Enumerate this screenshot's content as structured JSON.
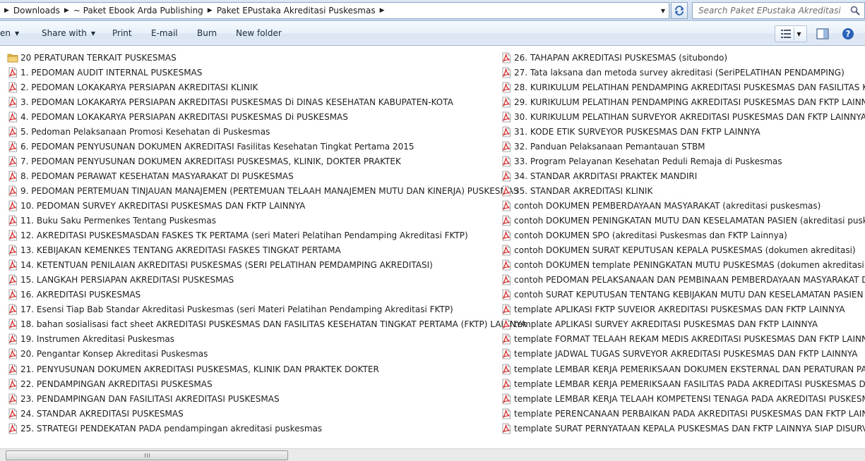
{
  "address_bar": {
    "crumbs": [
      "Downloads",
      "~ Paket Ebook Arda Publishing",
      "Paket EPustaka Akreditasi Puskesmas"
    ]
  },
  "search": {
    "placeholder": "Search Paket EPustaka Akreditasi Pus..."
  },
  "toolbar": {
    "organize_label": "en",
    "share_label": "Share with",
    "print_label": "Print",
    "email_label": "E-mail",
    "burn_label": "Burn",
    "new_folder_label": "New folder"
  },
  "files_left": [
    {
      "name": "20 PERATURAN TERKAIT PUSKESMAS",
      "icon": "folder-icon"
    },
    {
      "name": "1. PEDOMAN AUDIT INTERNAL PUSKESMAS",
      "icon": "pdf-icon"
    },
    {
      "name": "2. PEDOMAN LOKAKARYA PERSIAPAN AKREDITASI KLINIK",
      "icon": "pdf-icon"
    },
    {
      "name": "3. PEDOMAN LOKAKARYA PERSIAPAN AKREDITASI PUSKESMAS Di DINAS KESEHATAN KABUPATEN-KOTA",
      "icon": "pdf-icon"
    },
    {
      "name": "4. PEDOMAN LOKAKARYA PERSIAPAN AKREDITASI PUSKESMAS Di PUSKESMAS",
      "icon": "pdf-icon"
    },
    {
      "name": "5. Pedoman Pelaksanaan Promosi Kesehatan di Puskesmas",
      "icon": "pdf-icon"
    },
    {
      "name": "6. PEDOMAN PENYUSUNAN DOKUMEN AKREDITASI Fasilitas Kesehatan Tingkat Pertama 2015",
      "icon": "pdf-icon"
    },
    {
      "name": "7. PEDOMAN PENYUSUNAN DOKUMEN AKREDITASI PUSKESMAS, KLINIK, DOKTER PRAKTEK",
      "icon": "pdf-icon"
    },
    {
      "name": "8. PEDOMAN PERAWAT KESEHATAN MASYARAKAT DI PUSKESMAS",
      "icon": "pdf-icon"
    },
    {
      "name": "9. PEDOMAN PERTEMUAN TINJAUAN MANAJEMEN (PERTEMUAN TELAAH MANAJEMEN MUTU DAN KINERJA) PUSKESMAS",
      "icon": "pdf-icon"
    },
    {
      "name": "10. PEDOMAN SURVEY AKREDITASI PUSKESMAS DAN FKTP LAINNYA",
      "icon": "pdf-icon"
    },
    {
      "name": "11. Buku Saku Permenkes Tentang Puskesmas",
      "icon": "pdf-icon"
    },
    {
      "name": "12. AKREDITASI PUSKESMASDAN FASKES TK PERTAMA (seri Materi Pelatihan Pendamping Akreditasi FKTP)",
      "icon": "pdf-icon"
    },
    {
      "name": "13. KEBIJAKAN KEMENKES TENTANG AKREDITASI FASKES TINGKAT PERTAMA",
      "icon": "pdf-icon"
    },
    {
      "name": "14. KETENTUAN PENILAIAN AKREDITASI PUSKESMAS (SERI PELATIHAN PEMDAMPING AKREDITASI)",
      "icon": "pdf-icon"
    },
    {
      "name": "15. LANGKAH PERSIAPAN AKREDITASI PUSKESMAS",
      "icon": "pdf-icon"
    },
    {
      "name": "16. AKREDITASI PUSKESMAS",
      "icon": "pdf-icon"
    },
    {
      "name": "17. Esensi Tiap Bab Standar Akreditasi Puskesmas (seri Materi Pelatihan Pendamping Akreditasi FKTP)",
      "icon": "pdf-icon"
    },
    {
      "name": "18. bahan sosialisasi fact sheet AKREDITASI PUSKESMAS DAN FASILITAS KESEHATAN TINGKAT PERTAMA (FKTP) LAINNYA",
      "icon": "pdf-icon"
    },
    {
      "name": "19. Instrumen Akreditasi Puskesmas",
      "icon": "pdf-icon"
    },
    {
      "name": "20. Pengantar Konsep Akreditasi Puskesmas",
      "icon": "pdf-icon"
    },
    {
      "name": "21. PENYUSUNAN DOKUMEN AKREDITASI PUSKESMAS, KLINIK DAN PRAKTEK DOKTER",
      "icon": "pdf-icon"
    },
    {
      "name": "22. PENDAMPINGAN AKREDITASI PUSKESMAS",
      "icon": "pdf-icon"
    },
    {
      "name": "23. PENDAMPINGAN DAN FASILITASI AKREDITASI PUSKESMAS",
      "icon": "pdf-icon"
    },
    {
      "name": "24. STANDAR AKREDITASI PUSKESMAS",
      "icon": "pdf-icon"
    },
    {
      "name": "25. STRATEGI PENDEKATAN PADA pendampingan akreditasi puskesmas",
      "icon": "pdf-icon"
    }
  ],
  "files_right": [
    {
      "name": "26. TAHAPAN AKREDITASI PUSKESMAS (situbondo)",
      "icon": "pdf-icon"
    },
    {
      "name": "27. Tata laksana dan metoda survey akreditasi (SeriPELATIHAN PENDAMPING)",
      "icon": "pdf-icon"
    },
    {
      "name": "28. KURIKULUM PELATIHAN PENDAMPING AKREDITASI PUSKESMAS DAN FASILITAS KESEHAT",
      "icon": "pdf-icon"
    },
    {
      "name": "29. KURIKULUM PELATIHAN PENDAMPING AKREDITASI PUSKESMAS DAN FKTP LAINNYA",
      "icon": "pdf-icon"
    },
    {
      "name": "30. KURIKULUM PELATIHAN SURVEYOR AKREDITASI PUSKESMAS DAN FKTP LAINNYA",
      "icon": "pdf-icon"
    },
    {
      "name": "31. KODE ETIK SURVEYOR PUSKESMAS DAN FKTP LAINNYA",
      "icon": "pdf-icon"
    },
    {
      "name": "32. Panduan Pelaksanaan Pemantauan STBM",
      "icon": "pdf-icon"
    },
    {
      "name": "33. Program Pelayanan Kesehatan Peduli Remaja di Puskesmas",
      "icon": "pdf-icon"
    },
    {
      "name": "34. STANDAR AKRDITASI PRAKTEK MANDIRI",
      "icon": "pdf-icon"
    },
    {
      "name": "35. STANDAR AKREDITASI KLINIK",
      "icon": "pdf-icon"
    },
    {
      "name": "contoh DOKUMEN PEMBERDAYAAN MASYARAKAT (akreditasi puskesmas)",
      "icon": "pdf-icon"
    },
    {
      "name": "contoh DOKUMEN PENINGKATAN MUTU DAN KESELAMATAN PASIEN (akreditasi puskesmas)",
      "icon": "pdf-icon"
    },
    {
      "name": "contoh DOKUMEN SPO (akreditasi Puskesmas dan FKTP Lainnya)",
      "icon": "pdf-icon"
    },
    {
      "name": "contoh DOKUMEN SURAT KEPUTUSAN KEPALA PUSKESMAS (dokumen akreditasi)",
      "icon": "pdf-icon"
    },
    {
      "name": "contoh DOKUMEN template PENINGKATAN MUTU PUSKESMAS (dokumen akreditasi)",
      "icon": "pdf-icon"
    },
    {
      "name": "contoh PEDOMAN PELAKSANAAN DAN PEMBINAAN PEMBERDAYAAN MASYARAKAT DI PUS",
      "icon": "pdf-icon"
    },
    {
      "name": "contoh SURAT KEPUTUSAN TENTANG KEBIJAKAN MUTU DAN KESELAMATAN PASIEN AKRED",
      "icon": "pdf-icon"
    },
    {
      "name": "template APLIKASI FKTP SUVEIOR AKREDITASI PUSKESMAS DAN FKTP LAINNYA",
      "icon": "pdf-icon"
    },
    {
      "name": "template APLIKASI SURVEY AKREDITASI PUSKESMAS DAN FKTP LAINNYA",
      "icon": "pdf-icon"
    },
    {
      "name": "template FORMAT TELAAH REKAM MEDIS AKREDITASI PUSKESMAS DAN FKTP LAINNYA",
      "icon": "pdf-icon"
    },
    {
      "name": "template JADWAL TUGAS SURVEYOR AKREDITASI PUSKESMAS DAN FKTP LAINNYA",
      "icon": "pdf-icon"
    },
    {
      "name": "template LEMBAR KERJA PEMERIKSAAN DOKUMEN EKSTERNAL DAN PERATURAN PADA AKR",
      "icon": "pdf-icon"
    },
    {
      "name": "template LEMBAR KERJA PEMERIKSAAN FASILITAS PADA AKREDITASI PUSKESMAS DAN FKTP",
      "icon": "pdf-icon"
    },
    {
      "name": "template LEMBAR KERJA TELAAH KOMPETENSI TENAGA PADA AKREDITASI PUSKESMAS DAN",
      "icon": "pdf-icon"
    },
    {
      "name": "template PERENCANAAN PERBAIKAN PADA AKREDITASI PUSKESMAS DAN FKTP LAINNYA",
      "icon": "pdf-icon"
    },
    {
      "name": "template SURAT PERNYATAAN KEPALA PUSKESMAS DAN FKTP LAINNYA SIAP DISURVEY",
      "icon": "pdf-icon"
    }
  ],
  "scrollbar": {
    "position_fraction": 0.0
  }
}
